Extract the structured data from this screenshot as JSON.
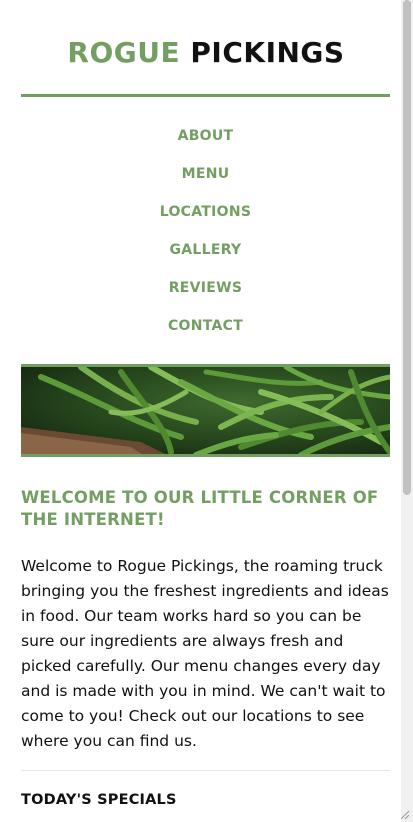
{
  "header": {
    "title_part1": "ROGUE",
    "title_part2": "PICKINGS"
  },
  "nav": {
    "items": [
      {
        "label": "ABOUT"
      },
      {
        "label": "MENU"
      },
      {
        "label": "LOCATIONS"
      },
      {
        "label": "GALLERY"
      },
      {
        "label": "REVIEWS"
      },
      {
        "label": "CONTACT"
      }
    ]
  },
  "hero": {
    "image_alt": "green beans"
  },
  "main": {
    "heading": "WELCOME TO OUR LITTLE CORNER OF THE INTERNET!",
    "paragraph": "Welcome to Rogue Pickings, the roaming truck bringing you the freshest ingredients and ideas in food. Our team works hard so you can be sure our ingredients are always fresh and picked carefully. Our menu changes every day and is made with you in mind. We can't wait to come to you! Check out our locations to see where you can find us.",
    "specials_heading": "TODAY'S SPECIALS"
  },
  "colors": {
    "accent": "#73a062",
    "text": "#111111"
  }
}
